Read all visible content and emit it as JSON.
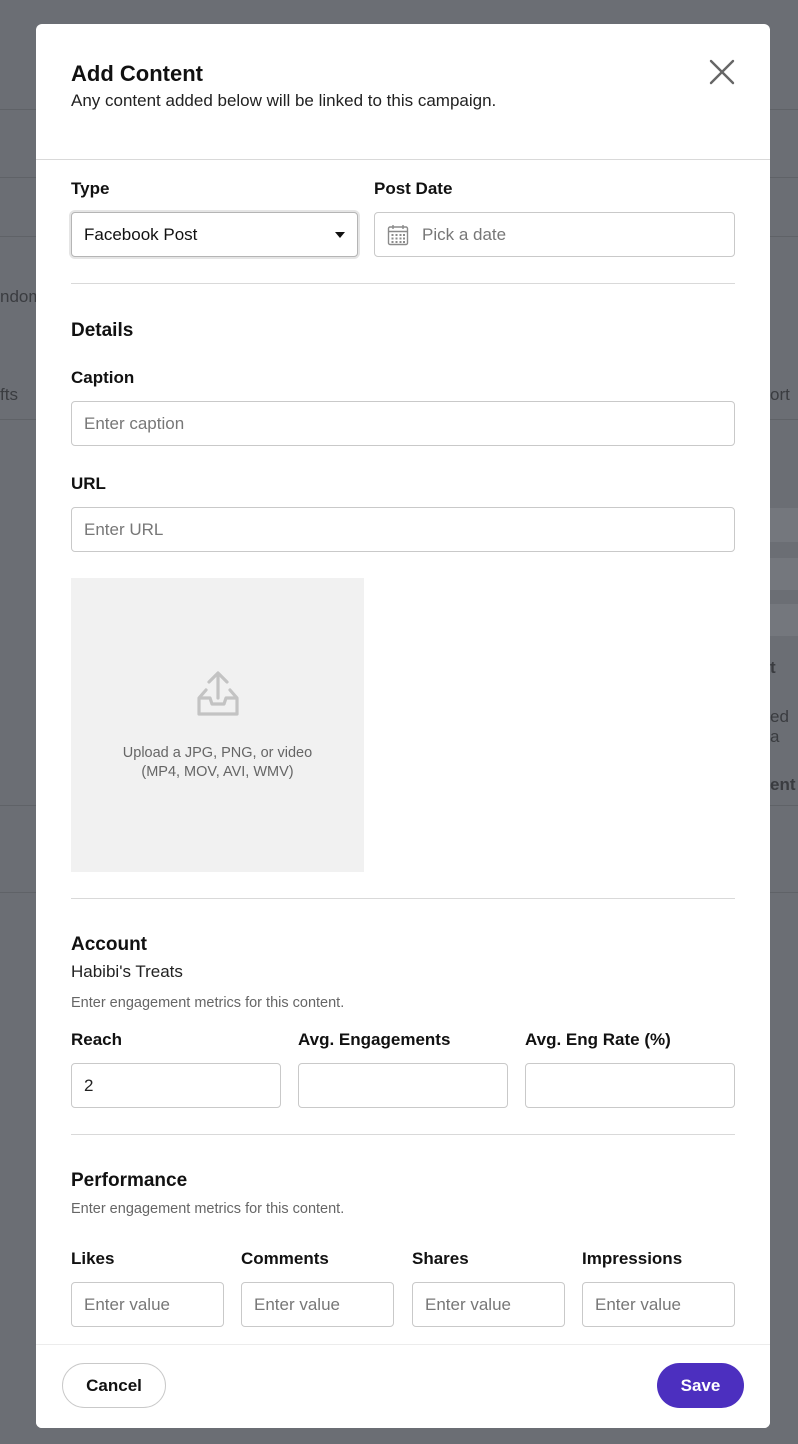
{
  "background": {
    "fragments": [
      "ndom",
      "fts",
      "ort",
      "t",
      "ed a",
      "ent"
    ]
  },
  "modal": {
    "title": "Add Content",
    "subtitle": "Any content added below will be linked to this campaign."
  },
  "type_field": {
    "label": "Type",
    "value": "Facebook Post"
  },
  "post_date": {
    "label": "Post Date",
    "placeholder": "Pick a date"
  },
  "details": {
    "title": "Details",
    "caption_label": "Caption",
    "caption_placeholder": "Enter caption",
    "url_label": "URL",
    "url_placeholder": "Enter URL",
    "upload_line1": "Upload a JPG, PNG, or video",
    "upload_line2": "(MP4, MOV, AVI, WMV)"
  },
  "account": {
    "title": "Account",
    "name": "Habibi's Treats",
    "helper": "Enter engagement metrics for this content.",
    "reach_label": "Reach",
    "reach_value": "2",
    "avg_eng_label": "Avg. Engagements",
    "avg_eng_value": "",
    "avg_eng_rate_label": "Avg. Eng Rate (%)",
    "avg_eng_rate_value": ""
  },
  "performance": {
    "title": "Performance",
    "helper": "Enter engagement metrics for this content.",
    "likes_label": "Likes",
    "comments_label": "Comments",
    "shares_label": "Shares",
    "impressions_label": "Impressions",
    "value_placeholder": "Enter value"
  },
  "footer": {
    "cancel": "Cancel",
    "save": "Save"
  },
  "colors": {
    "primary": "#4c2fbf",
    "overlay": "#6b6e74"
  }
}
